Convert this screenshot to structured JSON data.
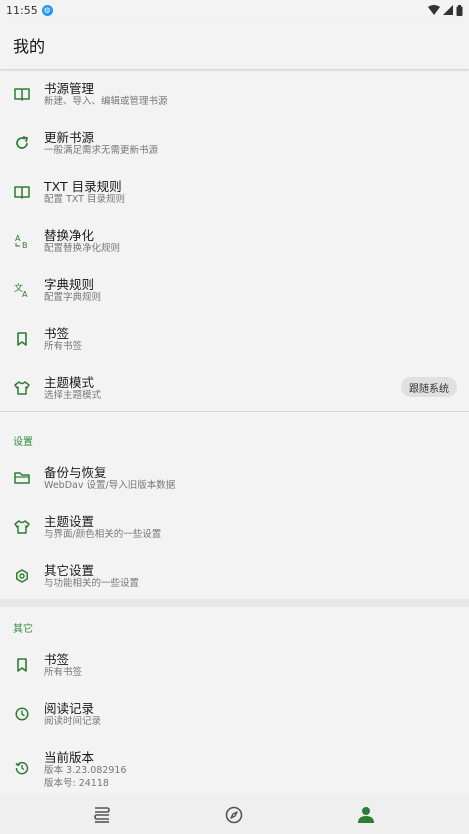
{
  "status_bar": {
    "time": "11:55"
  },
  "app_bar": {
    "title": "我的"
  },
  "items": [
    {
      "title": "书源管理",
      "subtitle": "新建、导入、编辑或管理书源",
      "icon": "book-open-icon"
    },
    {
      "title": "更新书源",
      "subtitle": "一般满足需求无需更新书源",
      "icon": "refresh-icon"
    },
    {
      "title": "TXT 目录规则",
      "subtitle": "配置 TXT 目录规则",
      "icon": "book-open-icon"
    },
    {
      "title": "替换净化",
      "subtitle": "配置替换净化规则",
      "icon": "replace-icon"
    },
    {
      "title": "字典规则",
      "subtitle": "配置字典规则",
      "icon": "translate-icon"
    },
    {
      "title": "书签",
      "subtitle": "所有书签",
      "icon": "bookmark-icon"
    },
    {
      "title": "主题模式",
      "subtitle": "选择主题模式",
      "icon": "shirt-icon"
    }
  ],
  "theme_mode_chip": "跟随系统",
  "settings_section": {
    "label": "设置",
    "items": [
      {
        "title": "备份与恢复",
        "subtitle": "WebDav 设置/导入旧版本数据",
        "icon": "folder-icon"
      },
      {
        "title": "主题设置",
        "subtitle": "与界面/颜色相关的一些设置",
        "icon": "shirt-icon"
      },
      {
        "title": "其它设置",
        "subtitle": "与功能相关的一些设置",
        "icon": "hexagon-gear-icon"
      }
    ]
  },
  "other_section": {
    "label": "其它",
    "items": [
      {
        "title": "书签",
        "subtitle": "所有书签",
        "icon": "bookmark-icon"
      },
      {
        "title": "阅读记录",
        "subtitle": "阅读时间记录",
        "icon": "clock-icon"
      },
      {
        "title": "当前版本",
        "subtitle": "版本 3.23.082916",
        "subtitle2": "版本号: 24118",
        "icon": "history-icon"
      }
    ]
  },
  "bottom_nav": [
    {
      "name": "bookshelf",
      "icon": "bookshelf-icon",
      "active": false
    },
    {
      "name": "discover",
      "icon": "compass-icon",
      "active": false
    },
    {
      "name": "my",
      "icon": "person-icon",
      "active": true
    }
  ],
  "colors": {
    "accent": "#2e8b3a",
    "icon_green": "#2e7d32"
  }
}
